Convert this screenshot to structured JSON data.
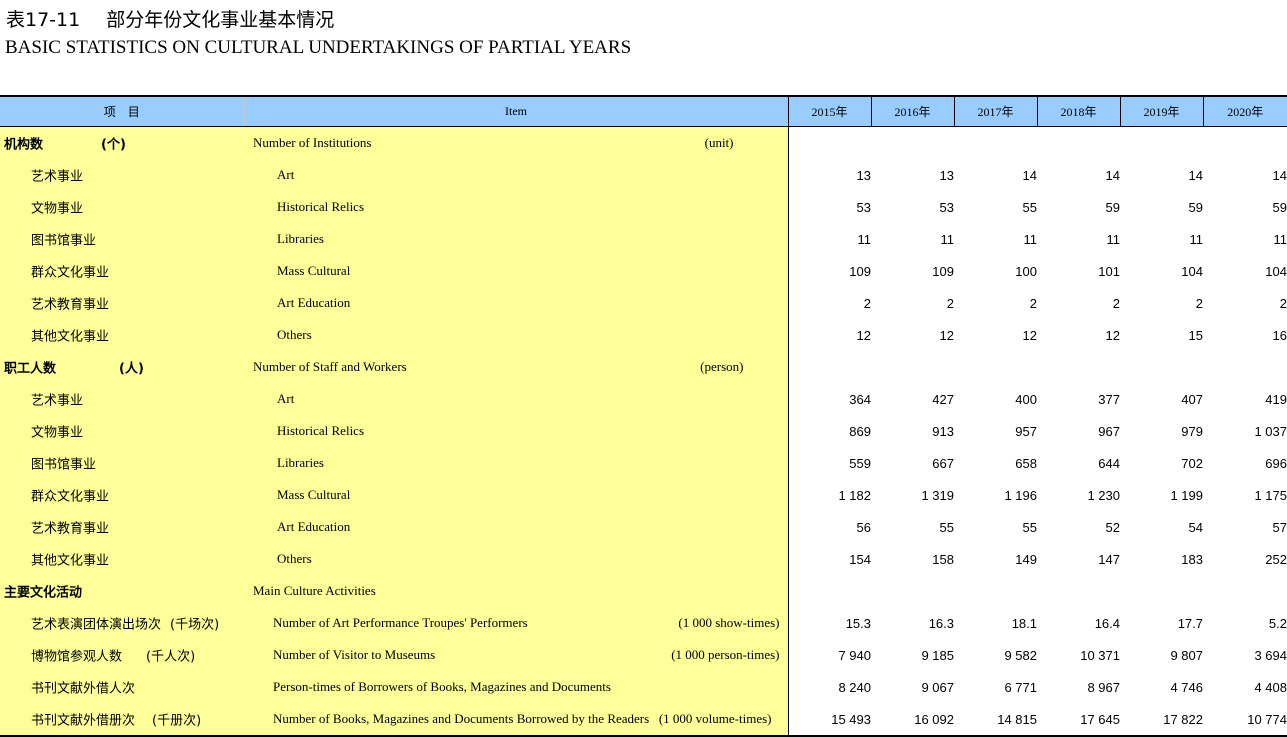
{
  "title": {
    "table_no": "表17-11",
    "cn": "部分年份文化事业基本情况",
    "en": "BASIC STATISTICS ON CULTURAL UNDERTAKINGS OF PARTIAL YEARS"
  },
  "header": {
    "item_cn": "项　目",
    "item_en": "Item",
    "years": [
      "2015年",
      "2016年",
      "2017年",
      "2018年",
      "2019年",
      "2020年"
    ]
  },
  "rows": [
    {
      "level": 0,
      "cn": "机构数",
      "cn_unit": "(个)",
      "en": "Number of  Institutions",
      "en_unit": "(unit)",
      "values": [
        "",
        "",
        "",
        "",
        "",
        ""
      ]
    },
    {
      "level": 1,
      "cn": "艺术事业",
      "cn_unit": "",
      "en": "Art",
      "en_unit": "",
      "values": [
        "13",
        "13",
        "14",
        "14",
        "14",
        "14"
      ]
    },
    {
      "level": 1,
      "cn": "文物事业",
      "cn_unit": "",
      "en": "Historical Relics",
      "en_unit": "",
      "values": [
        "53",
        "53",
        "55",
        "59",
        "59",
        "59"
      ]
    },
    {
      "level": 1,
      "cn": "图书馆事业",
      "cn_unit": "",
      "en": "Libraries",
      "en_unit": "",
      "values": [
        "11",
        "11",
        "11",
        "11",
        "11",
        "11"
      ]
    },
    {
      "level": 1,
      "cn": "群众文化事业",
      "cn_unit": "",
      "en": "Mass Cultural",
      "en_unit": "",
      "values": [
        "109",
        "109",
        "100",
        "101",
        "104",
        "104"
      ]
    },
    {
      "level": 1,
      "cn": "艺术教育事业",
      "cn_unit": "",
      "en": "Art Education",
      "en_unit": "",
      "values": [
        "2",
        "2",
        "2",
        "2",
        "2",
        "2"
      ]
    },
    {
      "level": 1,
      "cn": "其他文化事业",
      "cn_unit": "",
      "en": "Others",
      "en_unit": "",
      "values": [
        "12",
        "12",
        "12",
        "12",
        "15",
        "16"
      ]
    },
    {
      "level": 0,
      "cn": "职工人数",
      "cn_unit": "(人)",
      "en": "Number of  Staff and Workers",
      "en_unit": "(person)",
      "values": [
        "",
        "",
        "",
        "",
        "",
        ""
      ]
    },
    {
      "level": 1,
      "cn": "艺术事业",
      "cn_unit": "",
      "en": "Art",
      "en_unit": "",
      "values": [
        "364",
        "427",
        "400",
        "377",
        "407",
        "419"
      ]
    },
    {
      "level": 1,
      "cn": "文物事业",
      "cn_unit": "",
      "en": "Historical Relics",
      "en_unit": "",
      "values": [
        "869",
        "913",
        "957",
        "967",
        "979",
        "1 037"
      ]
    },
    {
      "level": 1,
      "cn": "图书馆事业",
      "cn_unit": "",
      "en": "Libraries",
      "en_unit": "",
      "values": [
        "559",
        "667",
        "658",
        "644",
        "702",
        "696"
      ]
    },
    {
      "level": 1,
      "cn": "群众文化事业",
      "cn_unit": "",
      "en": "Mass Cultural",
      "en_unit": "",
      "values": [
        "1 182",
        "1 319",
        "1 196",
        "1 230",
        "1 199",
        "1 175"
      ]
    },
    {
      "level": 1,
      "cn": "艺术教育事业",
      "cn_unit": "",
      "en": "Art Education",
      "en_unit": "",
      "values": [
        "56",
        "55",
        "55",
        "52",
        "54",
        "57"
      ]
    },
    {
      "level": 1,
      "cn": "其他文化事业",
      "cn_unit": "",
      "en": "Others",
      "en_unit": "",
      "values": [
        "154",
        "158",
        "149",
        "147",
        "183",
        "252"
      ]
    },
    {
      "level": 0,
      "cn": "主要文化活动",
      "cn_unit": "",
      "en": "Main Culture Activities",
      "en_unit": "",
      "values": [
        "",
        "",
        "",
        "",
        "",
        ""
      ]
    },
    {
      "level": 1,
      "cn": "艺术表演团体演出场次",
      "cn_unit": "(千场次)",
      "en": "Number of Art Performance Troupes' Performers",
      "en_unit": "(1 000 show-times)",
      "values": [
        "15.3",
        "16.3",
        "18.1",
        "16.4",
        "17.7",
        "5.2"
      ]
    },
    {
      "level": 1,
      "cn": "博物馆参观人数",
      "cn_unit": "(千人次)",
      "en": "Number of  Visitor to Museums",
      "en_unit": "(1 000 person-times)",
      "values": [
        "7 940",
        "9 185",
        "9 582",
        "10 371",
        "9 807",
        "3 694"
      ]
    },
    {
      "level": 1,
      "cn": "书刊文献外借人次",
      "cn_unit": "",
      "en": "Person-times of Borrowers of Books, Magazines and Documents",
      "en_unit": "",
      "values": [
        "8 240",
        "9 067",
        "6 771",
        "8 967",
        "4 746",
        "4 408"
      ]
    },
    {
      "level": 1,
      "cn": "书刊文献外借册次",
      "cn_unit": "(千册次)",
      "en": "Number of Books, Magazines and Documents Borrowed by the Readers",
      "en_unit": "(1 000 volume-times)",
      "values": [
        "15 493",
        "16 092",
        "14 815",
        "17 645",
        "17 822",
        "10 774"
      ]
    }
  ]
}
